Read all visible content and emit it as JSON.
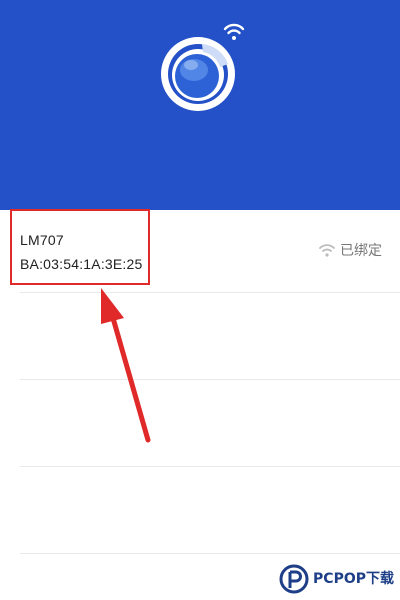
{
  "device": {
    "name": "LM707",
    "mac": "BA:03:54:1A:3E:25",
    "status": "已绑定",
    "status_icon": "wifi-icon"
  },
  "header": {
    "logo_icon": "device-logo-icon",
    "wifi_icon": "wifi-icon",
    "background_color": "#2450c8"
  },
  "annotation": {
    "highlight_color": "#e02a2a",
    "arrow_icon": "arrow-icon"
  },
  "watermark": {
    "text": "PCPOP下载"
  }
}
